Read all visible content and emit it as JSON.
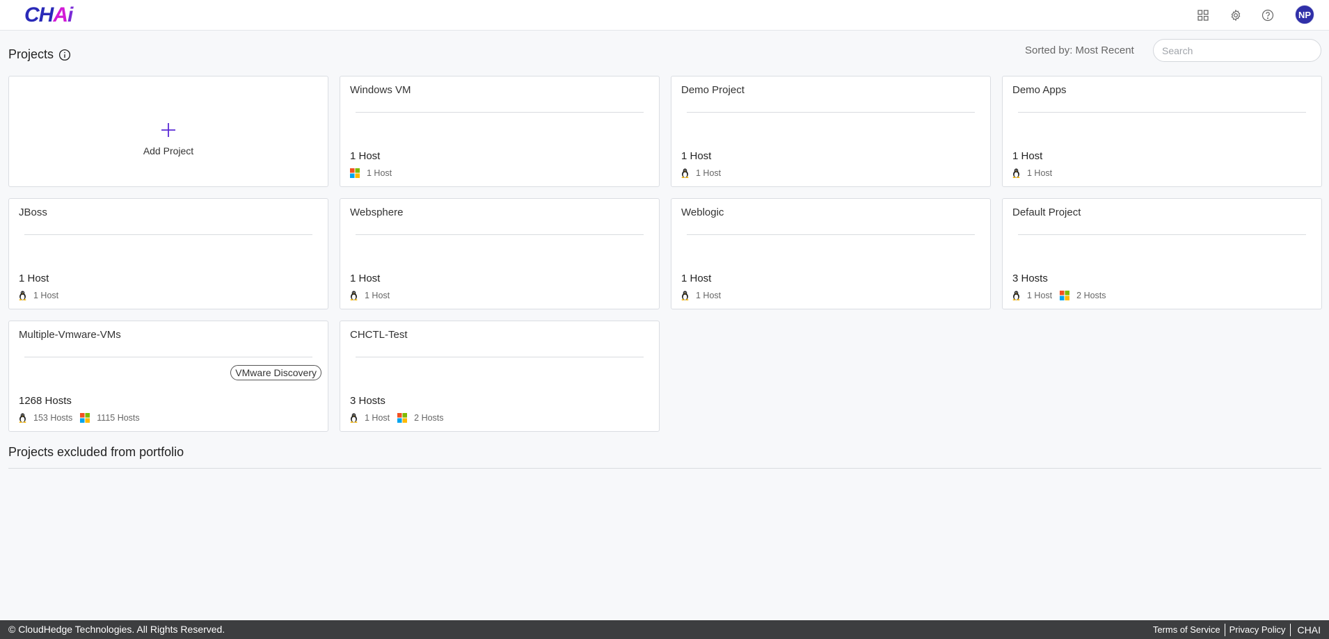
{
  "header": {
    "logo": {
      "part1": "CH",
      "part2": "A",
      "part3": "i"
    },
    "avatar_initials": "NP",
    "icons": [
      "apps-grid-icon",
      "gear-icon",
      "help-icon"
    ]
  },
  "toolbar": {
    "title": "Projects",
    "sorted_label": "Sorted by: Most Recent",
    "search_placeholder": "Search"
  },
  "add_project": {
    "label": "Add Project"
  },
  "projects": [
    {
      "title": "Windows VM",
      "total": "1 Host",
      "os": [
        {
          "type": "windows",
          "label": "1 Host"
        }
      ]
    },
    {
      "title": "Demo Project",
      "total": "1 Host",
      "os": [
        {
          "type": "linux",
          "label": "1 Host"
        }
      ]
    },
    {
      "title": "Demo Apps",
      "total": "1 Host",
      "os": [
        {
          "type": "linux",
          "label": "1 Host"
        }
      ]
    },
    {
      "title": "JBoss",
      "total": "1 Host",
      "os": [
        {
          "type": "linux",
          "label": "1 Host"
        }
      ]
    },
    {
      "title": "Websphere",
      "total": "1 Host",
      "os": [
        {
          "type": "linux",
          "label": "1 Host"
        }
      ]
    },
    {
      "title": "Weblogic",
      "total": "1 Host",
      "os": [
        {
          "type": "linux",
          "label": "1 Host"
        }
      ]
    },
    {
      "title": "Default Project",
      "total": "3 Hosts",
      "os": [
        {
          "type": "linux",
          "label": "1 Host"
        },
        {
          "type": "windows",
          "label": "2 Hosts"
        }
      ]
    },
    {
      "title": "Multiple-Vmware-VMs",
      "total": "1268 Hosts",
      "badge": "VMware Discovery",
      "os": [
        {
          "type": "linux",
          "label": "153 Hosts"
        },
        {
          "type": "windows",
          "label": "1115 Hosts"
        }
      ]
    },
    {
      "title": "CHCTL-Test",
      "total": "3 Hosts",
      "os": [
        {
          "type": "linux",
          "label": "1 Host"
        },
        {
          "type": "windows",
          "label": "2 Hosts"
        }
      ]
    }
  ],
  "excluded": {
    "title": "Projects excluded from portfolio"
  },
  "footer": {
    "copyright": "© CloudHedge Technologies. All Rights Reserved.",
    "terms": "Terms of Service",
    "privacy": "Privacy Policy",
    "brand": "CHAI"
  },
  "colors": {
    "accent": "#5a2ad6",
    "avatar_bg": "#2f2fa8",
    "footer_bg": "#3d3e40"
  }
}
